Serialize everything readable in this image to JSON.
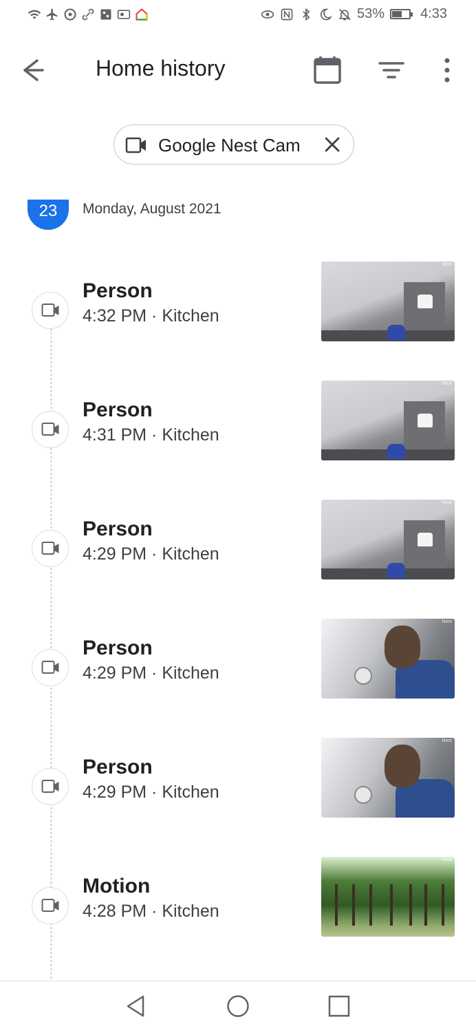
{
  "status_bar": {
    "battery": "53%",
    "time": "4:33",
    "battery_level": 0.53
  },
  "app_bar": {
    "title": "Home history"
  },
  "filter_chip": {
    "label": "Google Nest Cam"
  },
  "date_header": {
    "day": "23",
    "text": "Monday, August 2021"
  },
  "events": [
    {
      "type": "Person",
      "time_place": "4:32 PM · Kitchen",
      "thumb_watermark": "Nest",
      "thumb_scene": "room"
    },
    {
      "type": "Person",
      "time_place": "4:31 PM · Kitchen",
      "thumb_watermark": "Nest",
      "thumb_scene": "room"
    },
    {
      "type": "Person",
      "time_place": "4:29 PM · Kitchen",
      "thumb_watermark": "Nest",
      "thumb_scene": "room"
    },
    {
      "type": "Person",
      "time_place": "4:29 PM · Kitchen",
      "thumb_watermark": "Nest",
      "thumb_scene": "face"
    },
    {
      "type": "Person",
      "time_place": "4:29 PM · Kitchen",
      "thumb_watermark": "Nest",
      "thumb_scene": "face"
    },
    {
      "type": "Motion",
      "time_place": "4:28 PM · Kitchen",
      "thumb_watermark": "Nest",
      "thumb_scene": "forest"
    }
  ],
  "colors": {
    "accent": "#1a73e8",
    "text_primary": "#202124",
    "text_secondary": "#3c4043",
    "divider": "#dadce0"
  },
  "icons": {
    "status_left": [
      "wifi-icon",
      "airplane-icon",
      "data-saver-icon",
      "link-icon",
      "app-icon",
      "vpn-icon",
      "home-app-icon"
    ],
    "status_right": [
      "eye-comfort-icon",
      "nfc-icon",
      "bluetooth-icon",
      "moon-icon",
      "mute-icon",
      "battery-icon"
    ],
    "app_bar": [
      "back-arrow-icon",
      "calendar-icon",
      "filter-icon",
      "more-vert-icon"
    ],
    "chip": [
      "videocam-icon",
      "close-icon"
    ],
    "event": "videocam-icon",
    "nav": [
      "nav-back-icon",
      "nav-home-icon",
      "nav-recents-icon"
    ]
  }
}
